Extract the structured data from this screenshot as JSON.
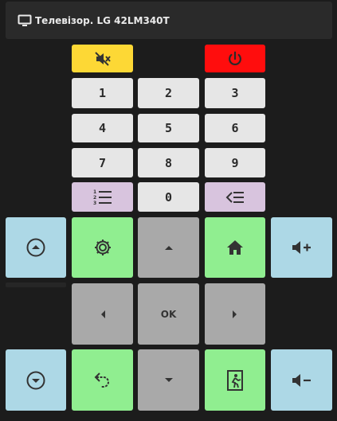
{
  "header": {
    "title": "Телевізор. LG 42LM340T",
    "icon": "tv-icon"
  },
  "keys": {
    "k1": "1",
    "k2": "2",
    "k3": "3",
    "k4": "4",
    "k5": "5",
    "k6": "6",
    "k7": "7",
    "k8": "8",
    "k9": "9",
    "k0": "0",
    "ok": "OK"
  },
  "icons": {
    "mute": "mute-icon",
    "power": "power-icon",
    "list": "numbered-list-icon",
    "back": "backspace-icon",
    "channel_up": "circle-up-icon",
    "settings": "gear-icon",
    "up": "arrow-up-icon",
    "home": "home-icon",
    "vol_up": "volume-up-icon",
    "left": "arrow-left-icon",
    "right": "arrow-right-icon",
    "channel_down": "circle-down-icon",
    "return": "return-icon",
    "down": "arrow-down-icon",
    "exit": "exit-icon",
    "vol_down": "volume-down-icon"
  },
  "colors": {
    "mute": "#fdd835",
    "power": "#ff0d0d",
    "number_keys": "#e6e6e6",
    "list_keys": "#d8c4de",
    "channel_volume": "#add8e6",
    "action_keys": "#90ee90",
    "navigation": "#a9a9a9"
  }
}
